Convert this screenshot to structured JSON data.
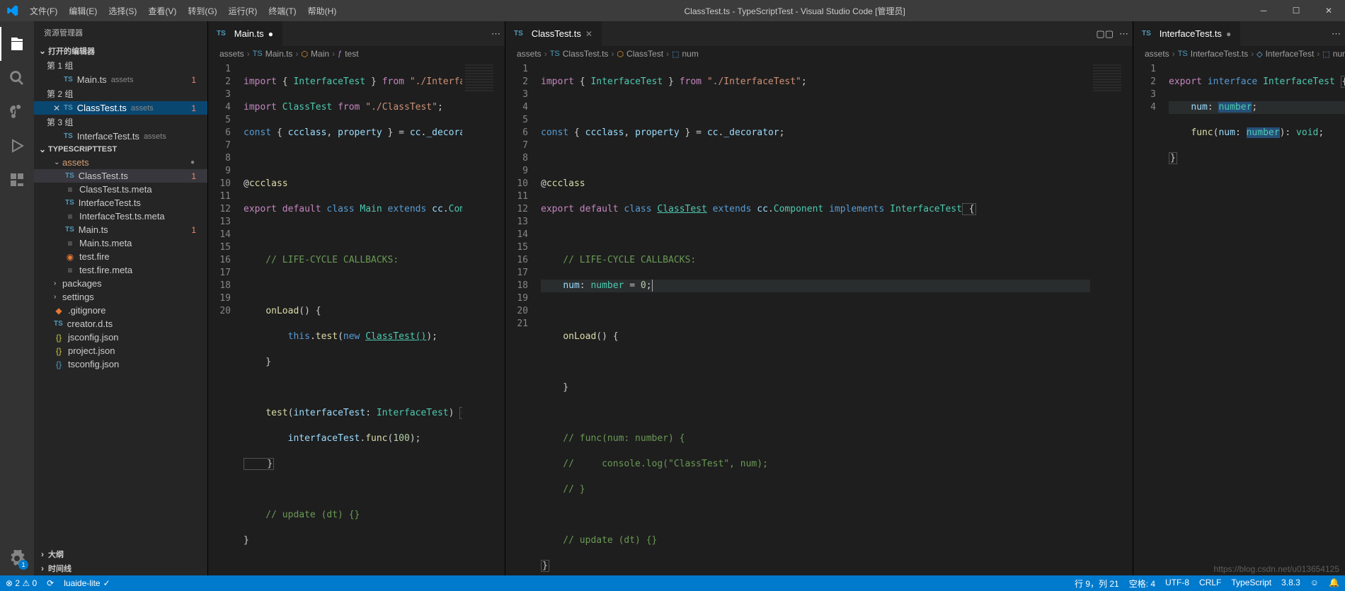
{
  "titlebar": {
    "menu": [
      "文件(F)",
      "编辑(E)",
      "选择(S)",
      "查看(V)",
      "转到(G)",
      "运行(R)",
      "终端(T)",
      "帮助(H)"
    ],
    "title": "ClassTest.ts - TypeScriptTest - Visual Studio Code [管理员]"
  },
  "sidebar": {
    "title": "资源管理器",
    "open_editors_label": "打开的编辑器",
    "group1": "第 1 组",
    "group2": "第 2 组",
    "group3": "第 3 组",
    "main_ts": "Main.ts",
    "classtest_ts": "ClassTest.ts",
    "interfacetest_ts": "InterfaceTest.ts",
    "assets": "assets",
    "err1": "1",
    "project_label": "TYPESCRIPTTEST",
    "assets_folder": "assets",
    "files": {
      "classtest": "ClassTest.ts",
      "classtest_m": "ClassTest.ts.meta",
      "interfacetest": "InterfaceTest.ts",
      "interfacetest_m": "InterfaceTest.ts.meta",
      "main": "Main.ts",
      "main_m": "Main.ts.meta",
      "testfire": "test.fire",
      "testfire_m": "test.fire.meta",
      "packages": "packages",
      "settings": "settings",
      "gitignore": ".gitignore",
      "creator": "creator.d.ts",
      "jsconfig": "jsconfig.json",
      "project": "project.json",
      "tsconfig": "tsconfig.json"
    },
    "outline": "大纲",
    "timeline": "时间线"
  },
  "editor1": {
    "tab": "Main.ts",
    "bc": [
      "assets",
      "Main.ts",
      "Main",
      "test"
    ],
    "lines": [
      "1",
      "2",
      "3",
      "4",
      "5",
      "6",
      "7",
      "8",
      "9",
      "10",
      "11",
      "12",
      "13",
      "14",
      "15",
      "16",
      "17",
      "18",
      "19",
      "20"
    ]
  },
  "editor2": {
    "tab": "ClassTest.ts",
    "bc": [
      "assets",
      "ClassTest.ts",
      "ClassTest",
      "num"
    ],
    "lines": [
      "1",
      "2",
      "3",
      "4",
      "5",
      "6",
      "7",
      "8",
      "9",
      "10",
      "11",
      "12",
      "13",
      "14",
      "15",
      "16",
      "17",
      "18",
      "19",
      "20",
      "21"
    ]
  },
  "editor3": {
    "tab": "InterfaceTest.ts",
    "bc": [
      "assets",
      "InterfaceTest.ts",
      "InterfaceTest",
      "num"
    ],
    "lines": [
      "1",
      "2",
      "3",
      "4"
    ]
  },
  "code": {
    "main": {
      "l1a": "import",
      "l1b": " { ",
      "l1c": "InterfaceTest",
      "l1d": " } ",
      "l1e": "from",
      "l1f": " \"./InterfaceTest\"",
      "l1g": ";",
      "l2a": "import",
      "l2b": " ",
      "l2c": "ClassTest",
      "l2d": " ",
      "l2e": "from",
      "l2f": " \"./ClassTest\"",
      "l2g": ";",
      "l3a": "const",
      "l3b": " { ",
      "l3c": "ccclass",
      "l3d": ", ",
      "l3e": "property",
      "l3f": " } = ",
      "l3g": "cc",
      "l3h": ".",
      "l3i": "_decorator",
      "l3j": ";",
      "l5a": "@",
      "l5b": "ccclass",
      "l6a": "export",
      "l6b": " default ",
      "l6c": "class",
      "l6d": " ",
      "l6e": "Main",
      "l6f": " ",
      "l6g": "extends",
      "l6h": " ",
      "l6i": "cc",
      "l6j": ".",
      "l6k": "Component",
      "l6l": " {",
      "l8": "    // LIFE-CYCLE CALLBACKS:",
      "l10a": "    ",
      "l10b": "onLoad",
      "l10c": "() {",
      "l11a": "        ",
      "l11b": "this",
      "l11c": ".",
      "l11d": "test",
      "l11e": "(",
      "l11f": "new",
      "l11g": " ",
      "l11h": "ClassTest",
      "l11i": "()",
      "l11j": ");",
      "l12": "    }",
      "l14a": "    ",
      "l14b": "test",
      "l14c": "(",
      "l14d": "interfaceTest",
      "l14e": ": ",
      "l14f": "InterfaceTest",
      "l14g": ") ",
      "l14h": "{",
      "l15a": "        ",
      "l15b": "interfaceTest",
      "l15c": ".",
      "l15d": "func",
      "l15e": "(",
      "l15f": "100",
      "l15g": ");",
      "l16": "    }",
      "l18": "    // update (dt) {}",
      "l19": "}"
    },
    "classtest": {
      "l1a": "import",
      "l1b": " { ",
      "l1c": "InterfaceTest",
      "l1d": " } ",
      "l1e": "from",
      "l1f": " \"./InterfaceTest\"",
      "l1g": ";",
      "l3a": "const",
      "l3b": " { ",
      "l3c": "ccclass",
      "l3d": ", ",
      "l3e": "property",
      "l3f": " } = ",
      "l3g": "cc",
      "l3h": ".",
      "l3i": "_decorator",
      "l3j": ";",
      "l5a": "@",
      "l5b": "ccclass",
      "l6a": "export",
      "l6b": " default ",
      "l6c": "class",
      "l6d": " ",
      "l6e": "ClassTest",
      "l6f": " ",
      "l6g": "extends",
      "l6h": " ",
      "l6i": "cc",
      "l6j": ".",
      "l6k": "Component",
      "l6l": " ",
      "l6m": "implements",
      "l6n": " ",
      "l6o": "InterfaceTest",
      "l6p": " {",
      "l8": "    // LIFE-CYCLE CALLBACKS:",
      "l9a": "    ",
      "l9b": "num",
      "l9c": ": ",
      "l9d": "number",
      "l9e": " = ",
      "l9f": "0",
      "l9g": ";",
      "l11a": "    ",
      "l11b": "onLoad",
      "l11c": "() {",
      "l13": "    }",
      "l15": "    // func(num: number) {",
      "l16": "    //     console.log(\"ClassTest\", num);",
      "l17": "    // }",
      "l19": "    // update (dt) {}",
      "l20": "}"
    },
    "iface": {
      "l1a": "export",
      "l1b": " ",
      "l1c": "interface",
      "l1d": " ",
      "l1e": "InterfaceTest",
      "l1f": " ",
      "l1g": "{",
      "l2a": "    ",
      "l2b": "num",
      "l2c": ": ",
      "l2d": "number",
      "l2e": ";",
      "l3a": "    ",
      "l3b": "func",
      "l3c": "(",
      "l3d": "num",
      "l3e": ": ",
      "l3f": "number",
      "l3g": "): ",
      "l3h": "void",
      "l3i": ";",
      "l4": "}"
    }
  },
  "statusbar": {
    "errors": "⊗ 2 ⚠ 0",
    "luaide": "luaide-lite",
    "ln": "行 9，列 21",
    "spaces": "空格: 4",
    "utf": "UTF-8",
    "crlf": "CRLF",
    "lang": "TypeScript",
    "ver": "3.8.3",
    "feedback": "☺",
    "bell": "🔔"
  },
  "watermark": "https://blog.csdn.net/u013654125"
}
